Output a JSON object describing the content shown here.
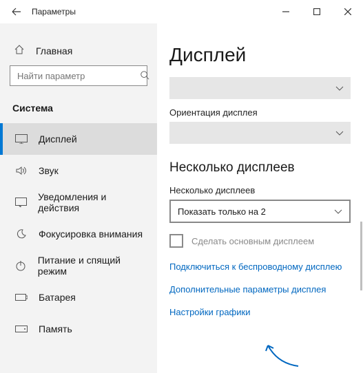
{
  "window": {
    "title": "Параметры"
  },
  "sidebar": {
    "home": "Главная",
    "search_placeholder": "Найти параметр",
    "category": "Система",
    "items": [
      {
        "label": "Дисплей"
      },
      {
        "label": "Звук"
      },
      {
        "label": "Уведомления и действия"
      },
      {
        "label": "Фокусировка внимания"
      },
      {
        "label": "Питание и спящий режим"
      },
      {
        "label": "Батарея"
      },
      {
        "label": "Память"
      }
    ]
  },
  "main": {
    "heading": "Дисплей",
    "orientation_label": "Ориентация дисплея",
    "multi_heading": "Несколько дисплеев",
    "multi_label": "Несколько дисплеев",
    "multi_value": "Показать только на 2",
    "make_primary": "Сделать основным дисплеем",
    "links": {
      "wireless": "Подключиться к беспроводному дисплею",
      "advanced": "Дополнительные параметры дисплея",
      "graphics": "Настройки графики"
    }
  }
}
